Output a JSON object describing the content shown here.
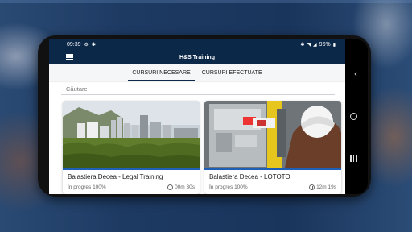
{
  "status_bar": {
    "time": "09:39",
    "battery": "96%",
    "icons": [
      "notification-icon",
      "bluetooth-icon",
      "wifi-icon",
      "signal-icon",
      "battery-icon"
    ]
  },
  "app_bar": {
    "title": "H&S Training",
    "menu_icon": "hamburger-menu-icon"
  },
  "tabs": [
    {
      "label": "CURSURI NECESARE",
      "active": true
    },
    {
      "label": "CURSURI EFECTUATE",
      "active": false
    }
  ],
  "search": {
    "placeholder": "Căutare"
  },
  "courses": [
    {
      "title": "Balastiera Decea - Legal Training",
      "progress": "În progres 100%",
      "duration": "00m 30s"
    },
    {
      "title": "Balastiera Decea - LOTOTO",
      "progress": "În progres 100%",
      "duration": "12m 19s"
    }
  ],
  "colors": {
    "primary": "#0c2848",
    "accent": "#1f5fb5",
    "background_blue": "#1e3a5f"
  }
}
